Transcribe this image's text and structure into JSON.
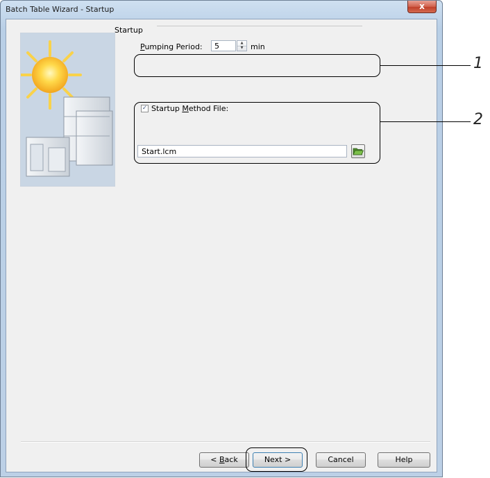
{
  "window": {
    "title": "Batch Table Wizard - Startup",
    "close_symbol": "x"
  },
  "startup": {
    "group_label": "Startup",
    "pumping_period": {
      "label_accel": "P",
      "label_rest": "umping Period:",
      "value": "5",
      "unit": "min"
    },
    "method_file": {
      "checked": true,
      "check_symbol": "✓",
      "label_pre": "Startup ",
      "label_accel": "M",
      "label_post": "ethod File:",
      "value": "Start.lcm"
    }
  },
  "buttons": {
    "back_pre": "< ",
    "back_accel": "B",
    "back_post": "ack",
    "next": "Next >",
    "cancel": "Cancel",
    "help": "Help"
  },
  "callouts": {
    "one": "1",
    "two": "2"
  }
}
